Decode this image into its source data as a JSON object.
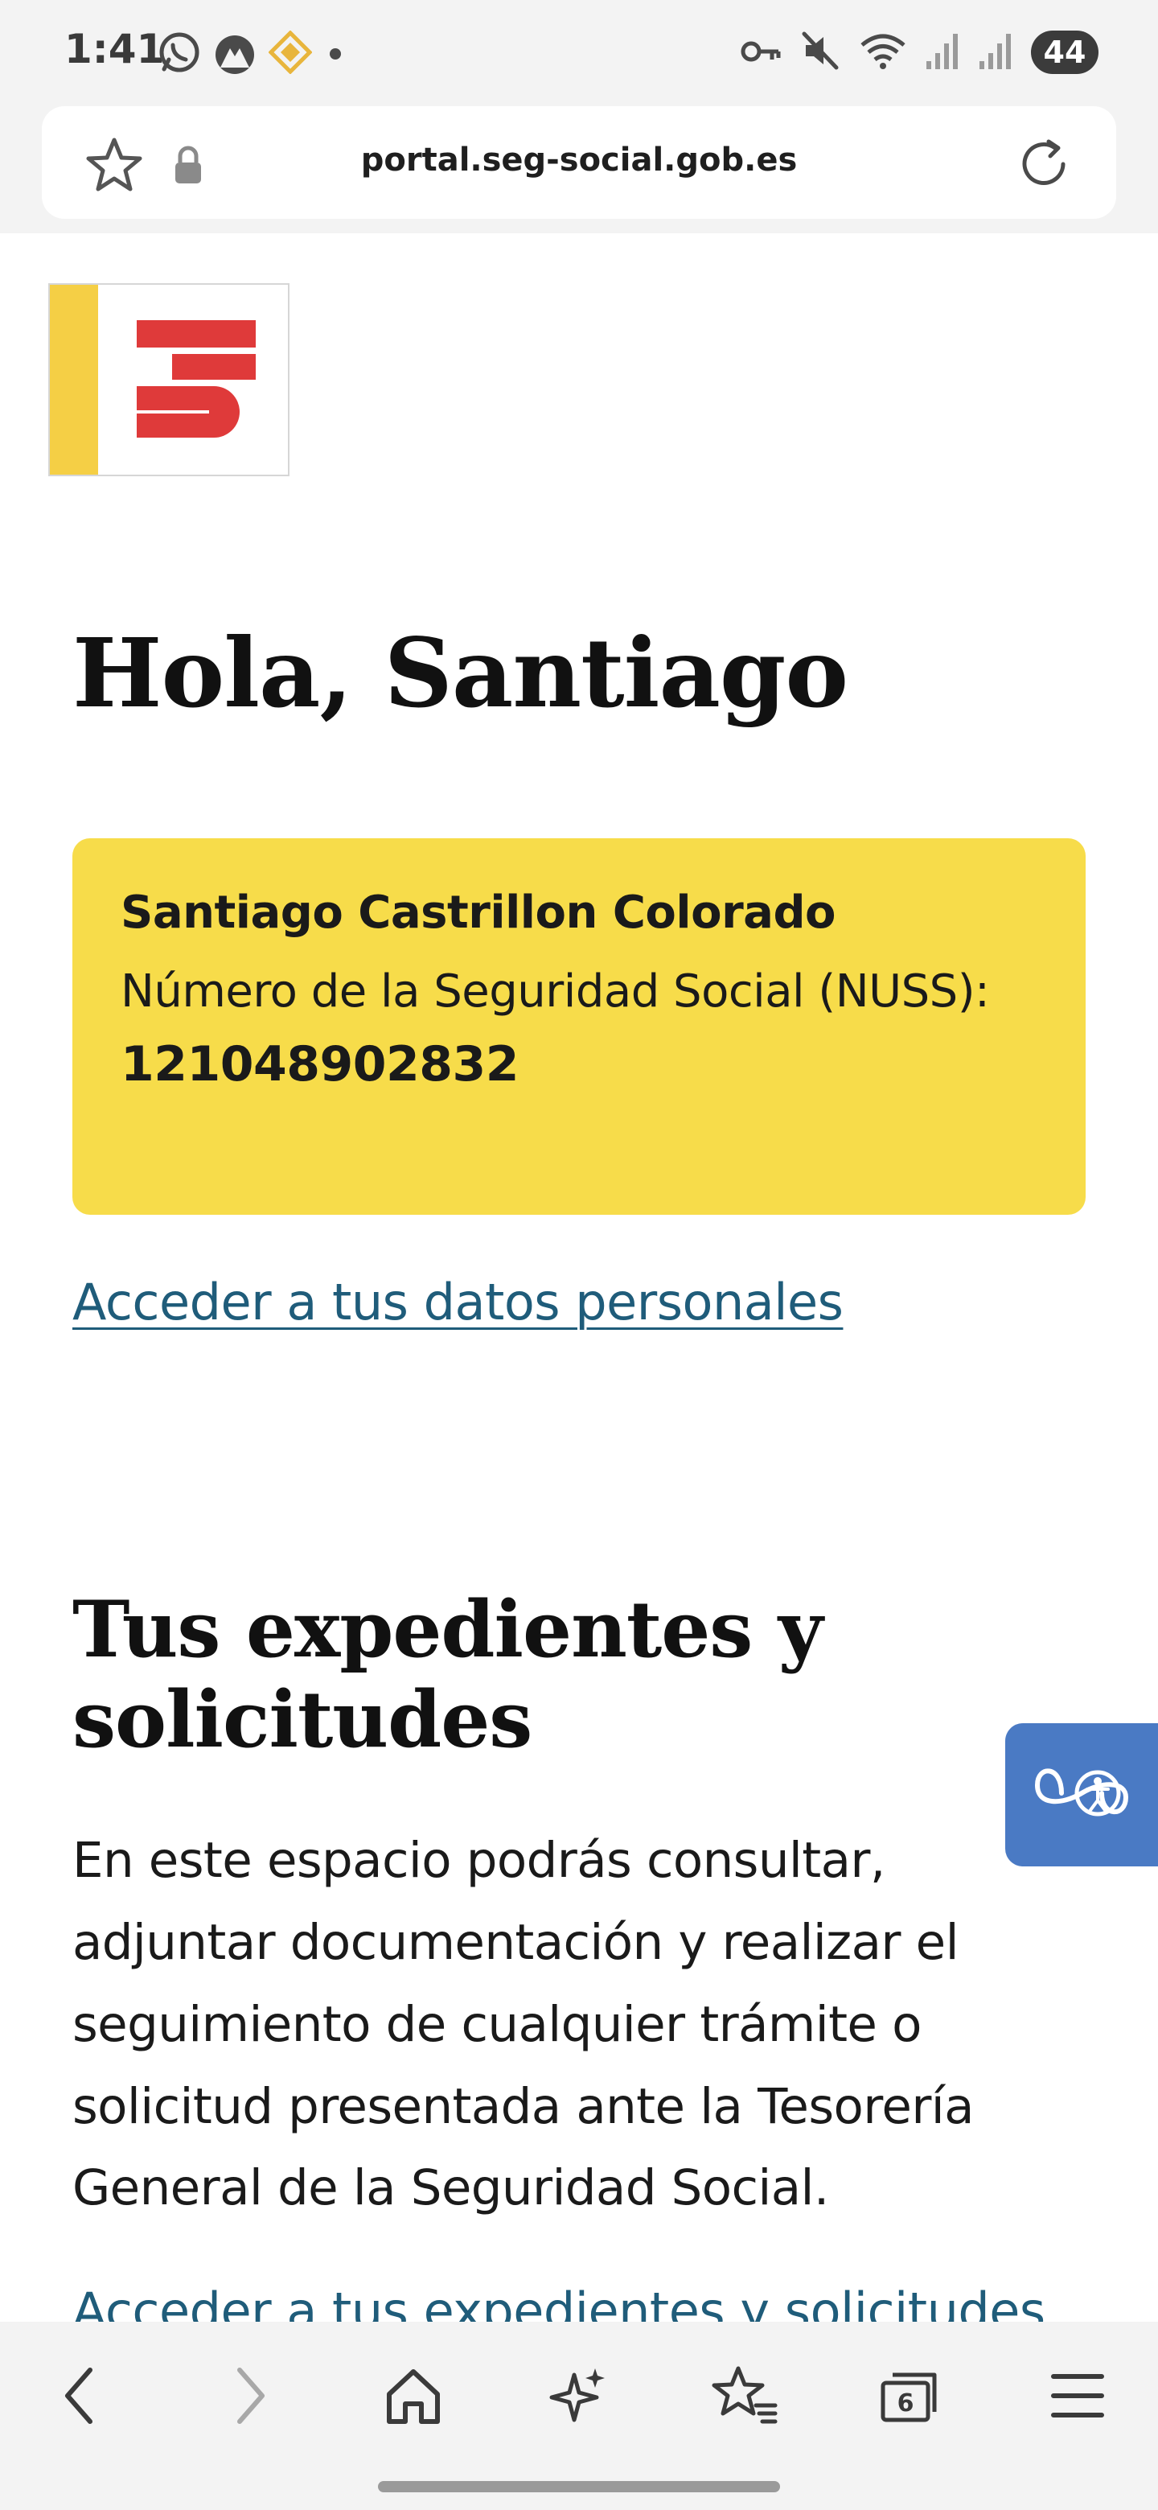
{
  "status_bar": {
    "time": "1:41",
    "battery": "44",
    "left_icons": [
      "whatsapp-icon",
      "app-icon",
      "binance-icon",
      "dot-icon"
    ],
    "right_icons": [
      "key-icon",
      "mute-icon",
      "wifi-icon",
      "signal-icon",
      "signal-icon"
    ]
  },
  "browser": {
    "url": "portal.seg-social.gob.es",
    "tab_count": "6"
  },
  "page": {
    "greeting": "Hola, Santiago",
    "user_card": {
      "name": "Santiago Castrillon Colorado",
      "nuss_label": "Número de la Seguridad Social (NUSS):",
      "nuss_value": "121048902832"
    },
    "personal_data_link": "Acceder a tus datos personales",
    "section": {
      "title": "Tus expedientes y solicitudes",
      "description": "En este espacio podrás consultar, adjuntar documentación y realizar el seguimiento de cualquier trámite o solicitud presentada ante la Tesorería General de la Seguridad Social.",
      "link": "Acceder a tus expedientes y solicitudes"
    }
  },
  "colors": {
    "card_yellow": "#f7dc4a",
    "logo_stripe": "#f5cf45",
    "logo_red": "#df3a3a",
    "link_blue": "#1f5c7a",
    "accessibility_blue": "#4a7ac4"
  }
}
